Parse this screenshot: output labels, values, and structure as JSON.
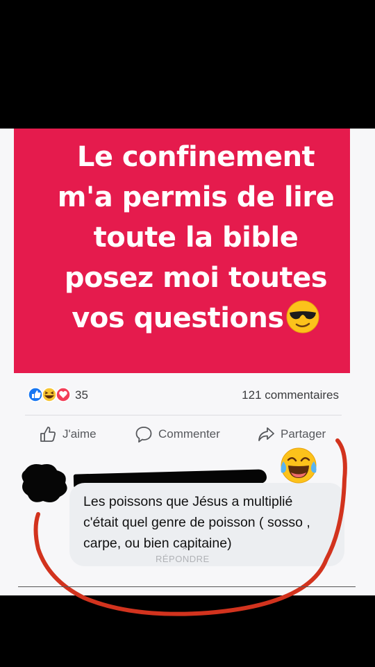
{
  "post": {
    "lines": [
      "Le confinement",
      "m'a permis de lire",
      "toute la bible",
      "posez moi toutes",
      "vos questions"
    ],
    "emoji": "smiling-face-with-sunglasses-icon",
    "background_color": "#e51b4d"
  },
  "reactions": {
    "icons": [
      "like-icon",
      "haha-icon",
      "love-icon"
    ],
    "count": "35",
    "comments": "121 commentaires"
  },
  "actions": {
    "like": "J'aime",
    "comment": "Commenter",
    "share": "Partager"
  },
  "comment": {
    "text": "Les poissons que Jésus a multiplié c'était quel genre de poisson ( sosso , carpe, ou bien capitaine)",
    "reply_label": "RÉPONDRE"
  },
  "annotation": {
    "emoji": "face-with-tears-of-joy-icon",
    "circle_color": "#d2331e"
  }
}
